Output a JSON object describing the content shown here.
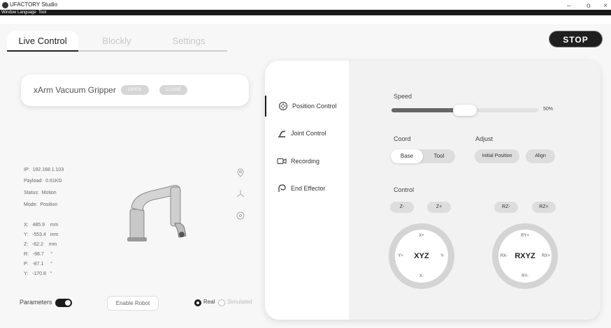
{
  "window": {
    "title": "UFACTORY Studio",
    "minimize": "–",
    "maximize": "o",
    "close": "×"
  },
  "menu": [
    "Window",
    "Language",
    "Tool"
  ],
  "tabs": [
    {
      "label": "Live Control",
      "active": true
    },
    {
      "label": "Blockly",
      "active": false
    },
    {
      "label": "Settings",
      "active": false
    }
  ],
  "stop_label": "STOP",
  "gripper": {
    "name": "xArm Vacuum Gripper",
    "open_label": "OPEN",
    "close_label": "CLOSE"
  },
  "status": {
    "ip": "IP:  192.168.1.103",
    "payload": "Payload:  0.61KG",
    "state": "Status:  Motion",
    "mode": "Mode:  Position"
  },
  "coords": [
    "X:   485.9    mm",
    "Y:   -553.4   mm",
    "Z:   -62.2    mm",
    "R:   -98.7     °",
    "P:   -87.1     °",
    "Y:   -170.8   °"
  ],
  "side_icons": [
    "location-icon",
    "axis-icon",
    "target-icon"
  ],
  "bottom": {
    "parameters_label": "Parameters",
    "parameters_on": true,
    "enable_label": "Enable Robot",
    "real_label": "Real",
    "simulated_label": "Simulated",
    "mode_selected": "Real"
  },
  "nav": [
    {
      "label": "Position Control",
      "icon": "position-icon",
      "active": true
    },
    {
      "label": "Joint Control",
      "icon": "joint-arm-icon",
      "active": false
    },
    {
      "label": "Recording",
      "icon": "video-camera-icon",
      "active": false
    },
    {
      "label": "End Effector",
      "icon": "gripper-icon",
      "active": false
    }
  ],
  "speed": {
    "label": "Speed",
    "value_text": "50%",
    "level": 0.5
  },
  "coord": {
    "label": "Coord",
    "options": [
      "Base",
      "Tool"
    ],
    "selected": "Base"
  },
  "adjust": {
    "label": "Adjust",
    "options": [
      "Initial Position",
      "Align"
    ]
  },
  "control": {
    "label": "Control",
    "z_minus": "Z-",
    "z_plus": "Z+",
    "rz_minus": "RZ-",
    "rz_plus": "RZ+",
    "xyz": {
      "center": "XYZ",
      "top": "X+",
      "bottom": "X-",
      "left": "Y+",
      "right": "Y-"
    },
    "rxyz": {
      "center": "RXYZ",
      "top": "RY+",
      "bottom": "RY-",
      "left": "RX-",
      "right": "RX+"
    }
  },
  "colors": {
    "accent": "#1a1a1a",
    "panel_bg": "#f2f2f2",
    "stop_bg": "#1f1f1f"
  }
}
